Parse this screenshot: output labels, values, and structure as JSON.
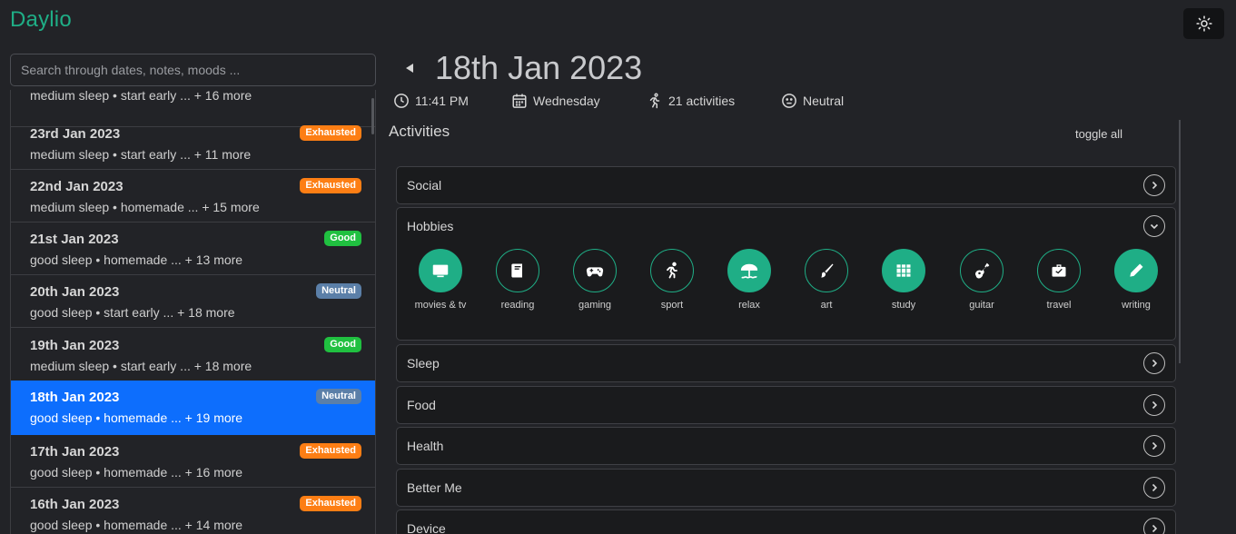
{
  "app": {
    "title": "Daylio"
  },
  "search": {
    "placeholder": "Search through dates, notes, moods ..."
  },
  "colors": {
    "accent": "#1fae86",
    "selected": "#0d6efd",
    "mood_exhausted": "#fd7e14",
    "mood_good": "#20c040",
    "mood_neutral": "#5b7fa8"
  },
  "days": [
    {
      "date": "",
      "summary": "medium sleep • start early ... + 16 more",
      "mood": ""
    },
    {
      "date": "23rd Jan 2023",
      "summary": "medium sleep • start early ... + 11 more",
      "mood": "Exhausted"
    },
    {
      "date": "22nd Jan 2023",
      "summary": "medium sleep • homemade ... + 15 more",
      "mood": "Exhausted"
    },
    {
      "date": "21st Jan 2023",
      "summary": "good sleep • homemade ... + 13 more",
      "mood": "Good"
    },
    {
      "date": "20th Jan 2023",
      "summary": "good sleep • start early ... + 18 more",
      "mood": "Neutral"
    },
    {
      "date": "19th Jan 2023",
      "summary": "medium sleep • start early ... + 18 more",
      "mood": "Good"
    },
    {
      "date": "18th Jan 2023",
      "summary": "good sleep • homemade ... + 19 more",
      "mood": "Neutral"
    },
    {
      "date": "17th Jan 2023",
      "summary": "good sleep • homemade ... + 16 more",
      "mood": "Exhausted"
    },
    {
      "date": "16th Jan 2023",
      "summary": "good sleep • homemade ... + 14 more",
      "mood": "Exhausted"
    }
  ],
  "detail": {
    "title": "18th Jan 2023",
    "time": "11:41 PM",
    "weekday": "Wednesday",
    "activities_count": "21 activities",
    "mood": "Neutral",
    "section_title": "Activities",
    "toggle_all": "toggle all"
  },
  "categories": [
    "Social",
    "Hobbies",
    "Sleep",
    "Food",
    "Health",
    "Better Me",
    "Device"
  ],
  "hobbies": [
    {
      "label": "movies & tv",
      "icon": "tv-icon",
      "selected": true
    },
    {
      "label": "reading",
      "icon": "book-icon",
      "selected": false
    },
    {
      "label": "gaming",
      "icon": "gamepad-icon",
      "selected": false
    },
    {
      "label": "sport",
      "icon": "running-icon",
      "selected": false
    },
    {
      "label": "relax",
      "icon": "beach-umbrella-icon",
      "selected": true
    },
    {
      "label": "art",
      "icon": "brush-icon",
      "selected": false
    },
    {
      "label": "study",
      "icon": "books-icon",
      "selected": true
    },
    {
      "label": "guitar",
      "icon": "guitar-icon",
      "selected": false
    },
    {
      "label": "travel",
      "icon": "suitcase-icon",
      "selected": false
    },
    {
      "label": "writing",
      "icon": "pen-icon",
      "selected": true
    }
  ]
}
